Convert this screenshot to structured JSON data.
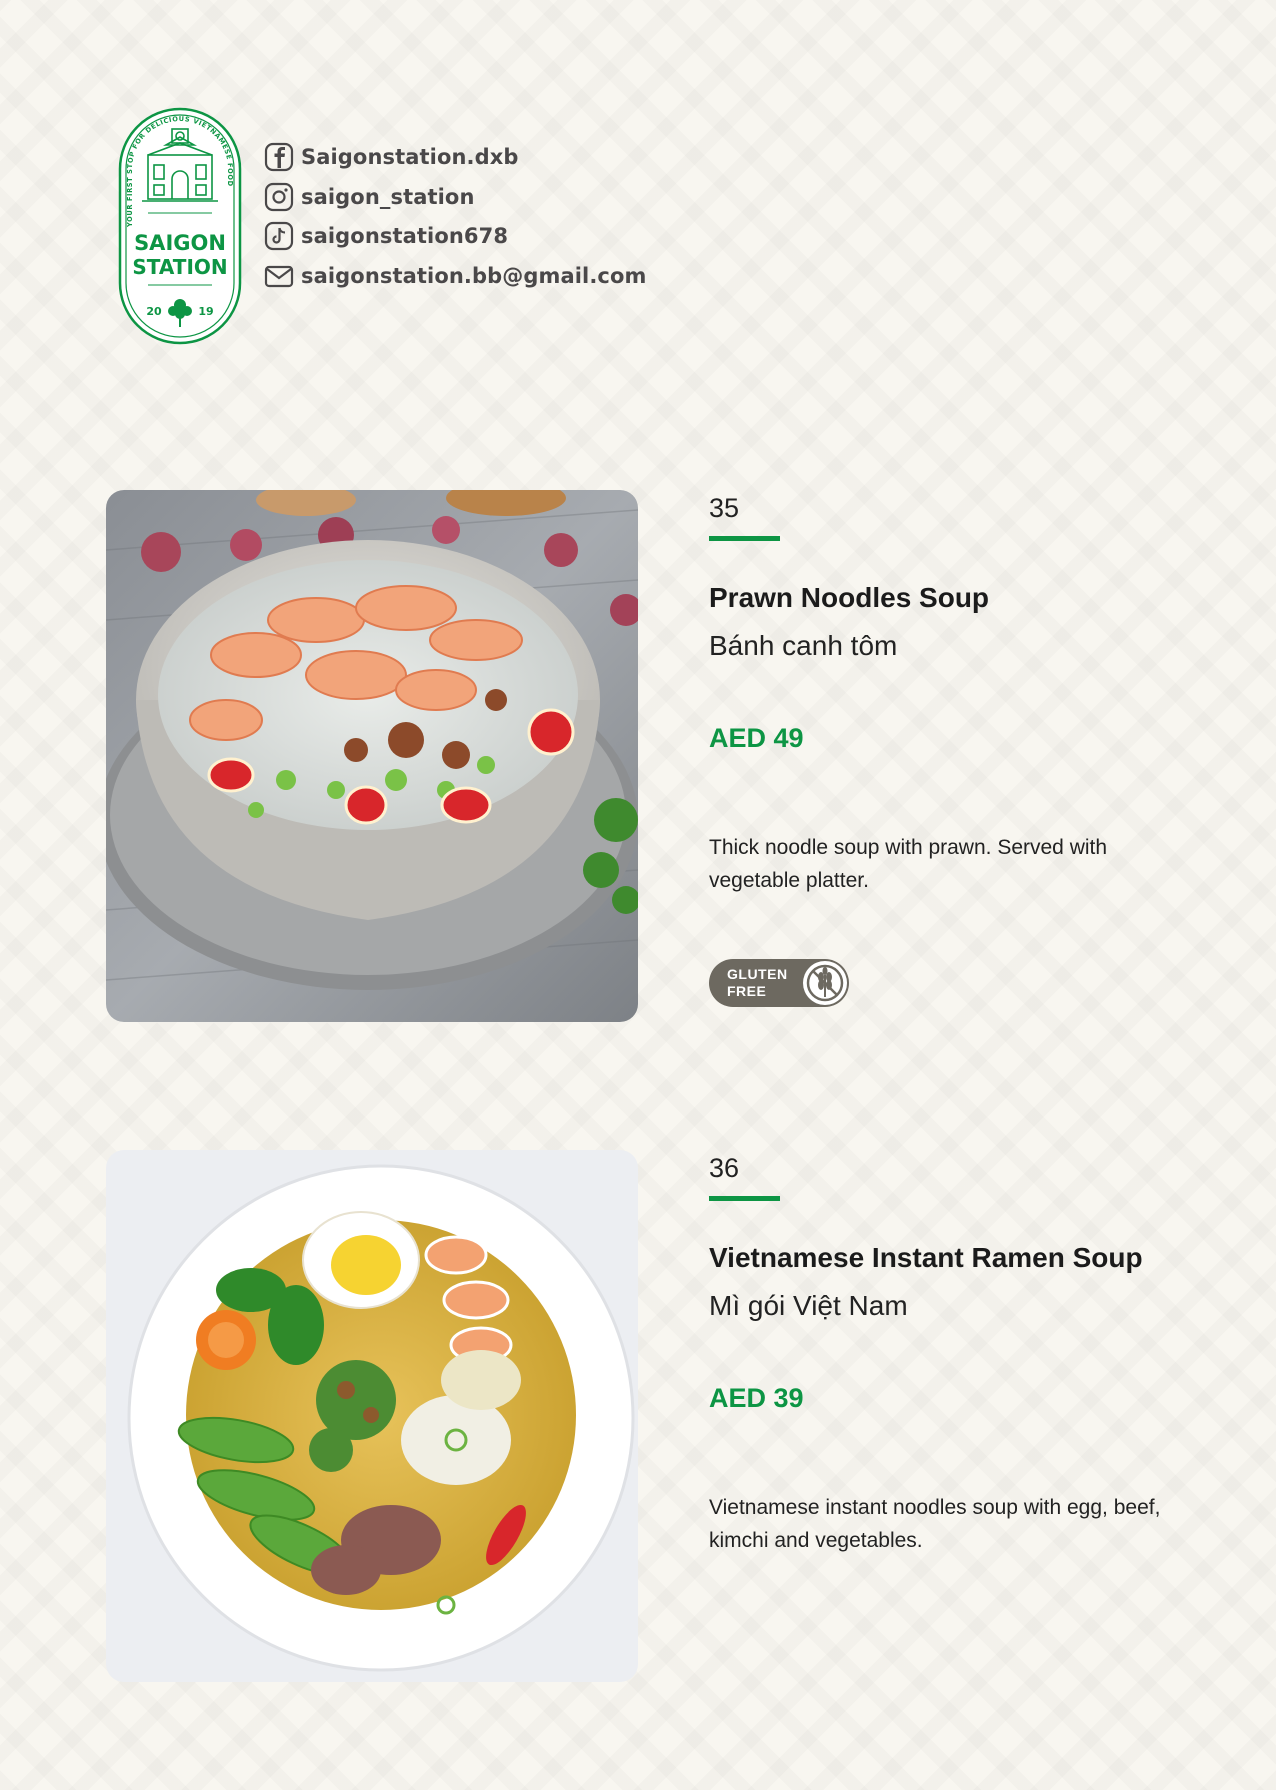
{
  "brand": {
    "logo_line1": "SAIGON",
    "logo_line2": "STATION",
    "logo_ring_text": "YOUR FIRST STOP FOR DELICIOUS VIETNAMESE FOOD",
    "year_left": "20",
    "year_right": "19",
    "accent_color": "#0d9544"
  },
  "contacts": [
    {
      "icon": "facebook-icon",
      "text": "Saigonstation.dxb"
    },
    {
      "icon": "instagram-icon",
      "text": "saigon_station"
    },
    {
      "icon": "tiktok-icon",
      "text": "saigonstation678"
    },
    {
      "icon": "email-icon",
      "text": "saigonstation.bb@gmail.com"
    }
  ],
  "dishes": [
    {
      "number": "35",
      "name_en": "Prawn Noodles Soup",
      "name_vi": "Bánh canh tôm",
      "price": "AED 49",
      "description": "Thick noodle soup with prawn.  Served with vegetable platter.",
      "badge": {
        "line1": "GLUTEN",
        "line2": "FREE",
        "icon": "wheat-crossed-icon"
      },
      "photo": "prawn-noodle-soup-photo"
    },
    {
      "number": "36",
      "name_en": "Vietnamese Instant Ramen Soup",
      "name_vi": "Mì gói Việt Nam",
      "price": "AED 39",
      "description": "Vietnamese instant noodles soup with egg, beef, kimchi and vegetables.",
      "photo": "instant-ramen-soup-photo"
    }
  ]
}
